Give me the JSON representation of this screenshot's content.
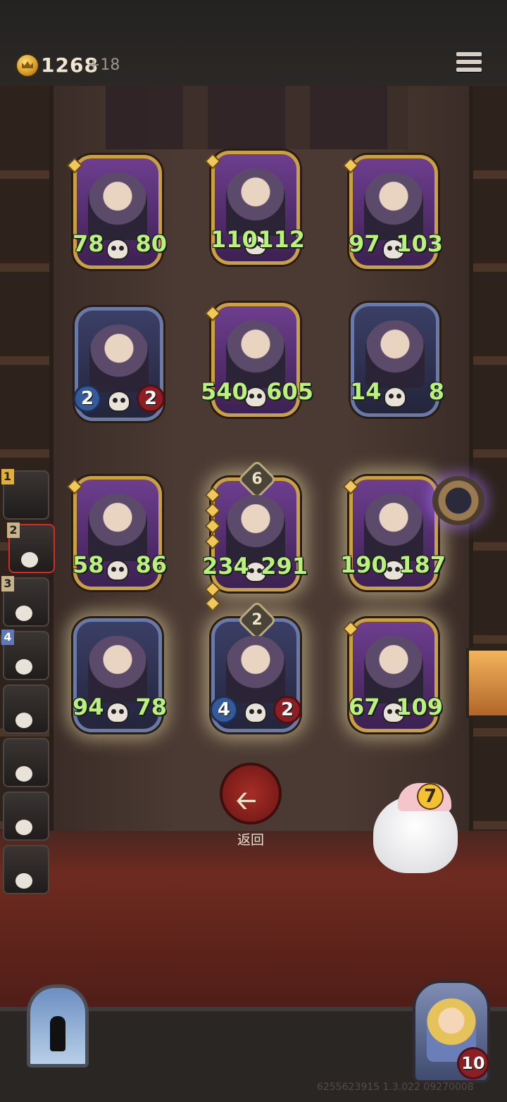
{
  "header": {
    "gold": "1268",
    "gold_income": "+18"
  },
  "board": {
    "cards": [
      {
        "attack": "78",
        "health": "80",
        "frame": "gold"
      },
      {
        "attack": "110",
        "health": "112",
        "frame": "gold"
      },
      {
        "attack": "97",
        "health": "103",
        "frame": "gold"
      },
      {
        "attack": "2",
        "health": "2",
        "frame": "blue"
      },
      {
        "attack": "540",
        "health": "605",
        "frame": "gold"
      },
      {
        "attack": "14",
        "health": "8",
        "frame": "blue"
      },
      {
        "attack": "58",
        "health": "86",
        "frame": "gold"
      },
      {
        "attack": "234",
        "health": "291",
        "frame": "gold",
        "level": "6"
      },
      {
        "attack": "190",
        "health": "187",
        "frame": "gold"
      },
      {
        "attack": "94",
        "health": "78",
        "frame": "blue"
      },
      {
        "attack": "4",
        "health": "2",
        "frame": "blue",
        "level": "2"
      },
      {
        "attack": "67",
        "health": "109",
        "frame": "gold"
      }
    ],
    "back_label": "返回"
  },
  "sidebar": {
    "slots": [
      "1",
      "2",
      "3",
      "4",
      "",
      "",
      "",
      ""
    ]
  },
  "companion": {
    "counter": "7"
  },
  "hero": {
    "health": "10"
  },
  "footer": {
    "version": "6255623915 1.3.022 09270008"
  }
}
